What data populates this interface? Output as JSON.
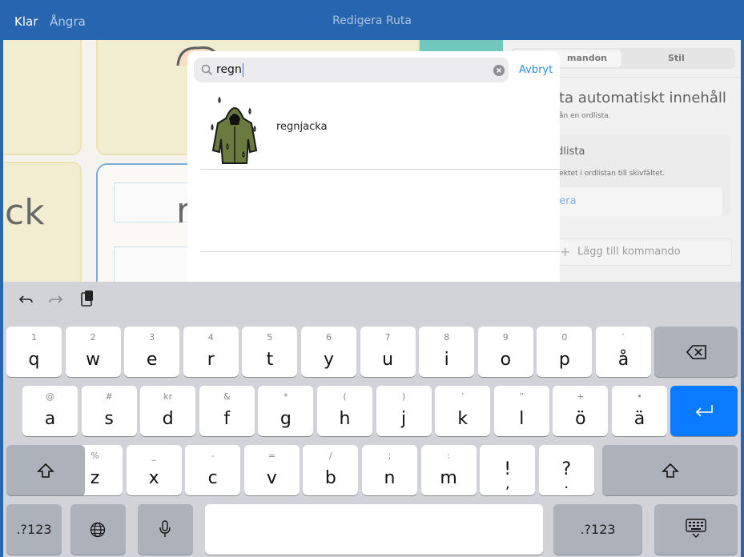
{
  "topbar": {
    "done": "Klar",
    "undo": "Ångra",
    "title": "Redigera Ruta"
  },
  "background": {
    "cell_text_1": "ck",
    "cell_text_2": "r"
  },
  "panel": {
    "tab_commands": "mandon",
    "tab_style": "Stil",
    "heading": "ta automatiskt innehåll",
    "subtext": "ån en ordlista.",
    "card_title": "rdlista",
    "card_text": "bjektet i ordlistan till skivfältet.",
    "card_link": "gera",
    "add_command": "Lägg till kommando"
  },
  "search": {
    "query": "regn",
    "cancel": "Avbryt"
  },
  "results": [
    {
      "label": "regnjacka",
      "icon": "raincoat-icon"
    }
  ],
  "keyboard": {
    "row1": [
      {
        "p": "q",
        "s": "1"
      },
      {
        "p": "w",
        "s": "2"
      },
      {
        "p": "e",
        "s": "3"
      },
      {
        "p": "r",
        "s": "4"
      },
      {
        "p": "t",
        "s": "5"
      },
      {
        "p": "y",
        "s": "6"
      },
      {
        "p": "u",
        "s": "7"
      },
      {
        "p": "i",
        "s": "8"
      },
      {
        "p": "o",
        "s": "9"
      },
      {
        "p": "p",
        "s": "0"
      },
      {
        "p": "å",
        "s": "`"
      }
    ],
    "row2": [
      {
        "p": "a",
        "s": "@"
      },
      {
        "p": "s",
        "s": "#"
      },
      {
        "p": "d",
        "s": "kr"
      },
      {
        "p": "f",
        "s": "&"
      },
      {
        "p": "g",
        "s": "*"
      },
      {
        "p": "h",
        "s": "("
      },
      {
        "p": "j",
        "s": ")"
      },
      {
        "p": "k",
        "s": "’"
      },
      {
        "p": "l",
        "s": "”"
      },
      {
        "p": "ö",
        "s": "+"
      },
      {
        "p": "ä",
        "s": "•"
      }
    ],
    "row3": [
      {
        "p": "z",
        "s": "%"
      },
      {
        "p": "x",
        "s": "_"
      },
      {
        "p": "c",
        "s": "-"
      },
      {
        "p": "v",
        "s": "="
      },
      {
        "p": "b",
        "s": "/"
      },
      {
        "p": "n",
        "s": ";"
      },
      {
        "p": "m",
        "s": ":"
      },
      {
        "p": "!",
        "s": ""
      },
      {
        "p": "?",
        "s": ""
      }
    ],
    "row3_under": [
      ",",
      "."
    ],
    "numbers_left": ".?123",
    "numbers_right": ".?123"
  },
  "colors": {
    "accent": "#2865b0",
    "return_key": "#0a7aff",
    "raincoat": "#6b7a3e"
  }
}
